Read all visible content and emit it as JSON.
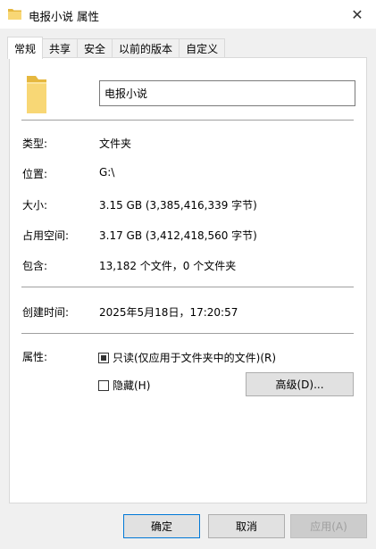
{
  "window": {
    "title": "电报小说 属性",
    "close_glyph": "✕"
  },
  "tabs": [
    {
      "label": "常规"
    },
    {
      "label": "共享"
    },
    {
      "label": "安全"
    },
    {
      "label": "以前的版本"
    },
    {
      "label": "自定义"
    }
  ],
  "general": {
    "name_value": "电报小说",
    "type_label": "类型:",
    "type_value": "文件夹",
    "location_label": "位置:",
    "location_value": "G:\\",
    "size_label": "大小:",
    "size_value": "3.15 GB (3,385,416,339 字节)",
    "disk_size_label": "占用空间:",
    "disk_size_value": "3.17 GB (3,412,418,560 字节)",
    "contains_label": "包含:",
    "contains_value": "13,182 个文件，0 个文件夹",
    "created_label": "创建时间:",
    "created_value": "2025年5月18日，17:20:57",
    "attributes_label": "属性:",
    "readonly_label": "只读(仅应用于文件夹中的文件)(R)",
    "readonly_state": "indeterminate",
    "hidden_label": "隐藏(H)",
    "hidden_checked": false,
    "advanced_label": "高级(D)..."
  },
  "footer": {
    "ok_label": "确定",
    "cancel_label": "取消",
    "apply_label": "应用(A)"
  },
  "colors": {
    "folder_yellow": "#f8d775",
    "folder_dark": "#e6b83f",
    "focus_blue": "#0078d7"
  }
}
